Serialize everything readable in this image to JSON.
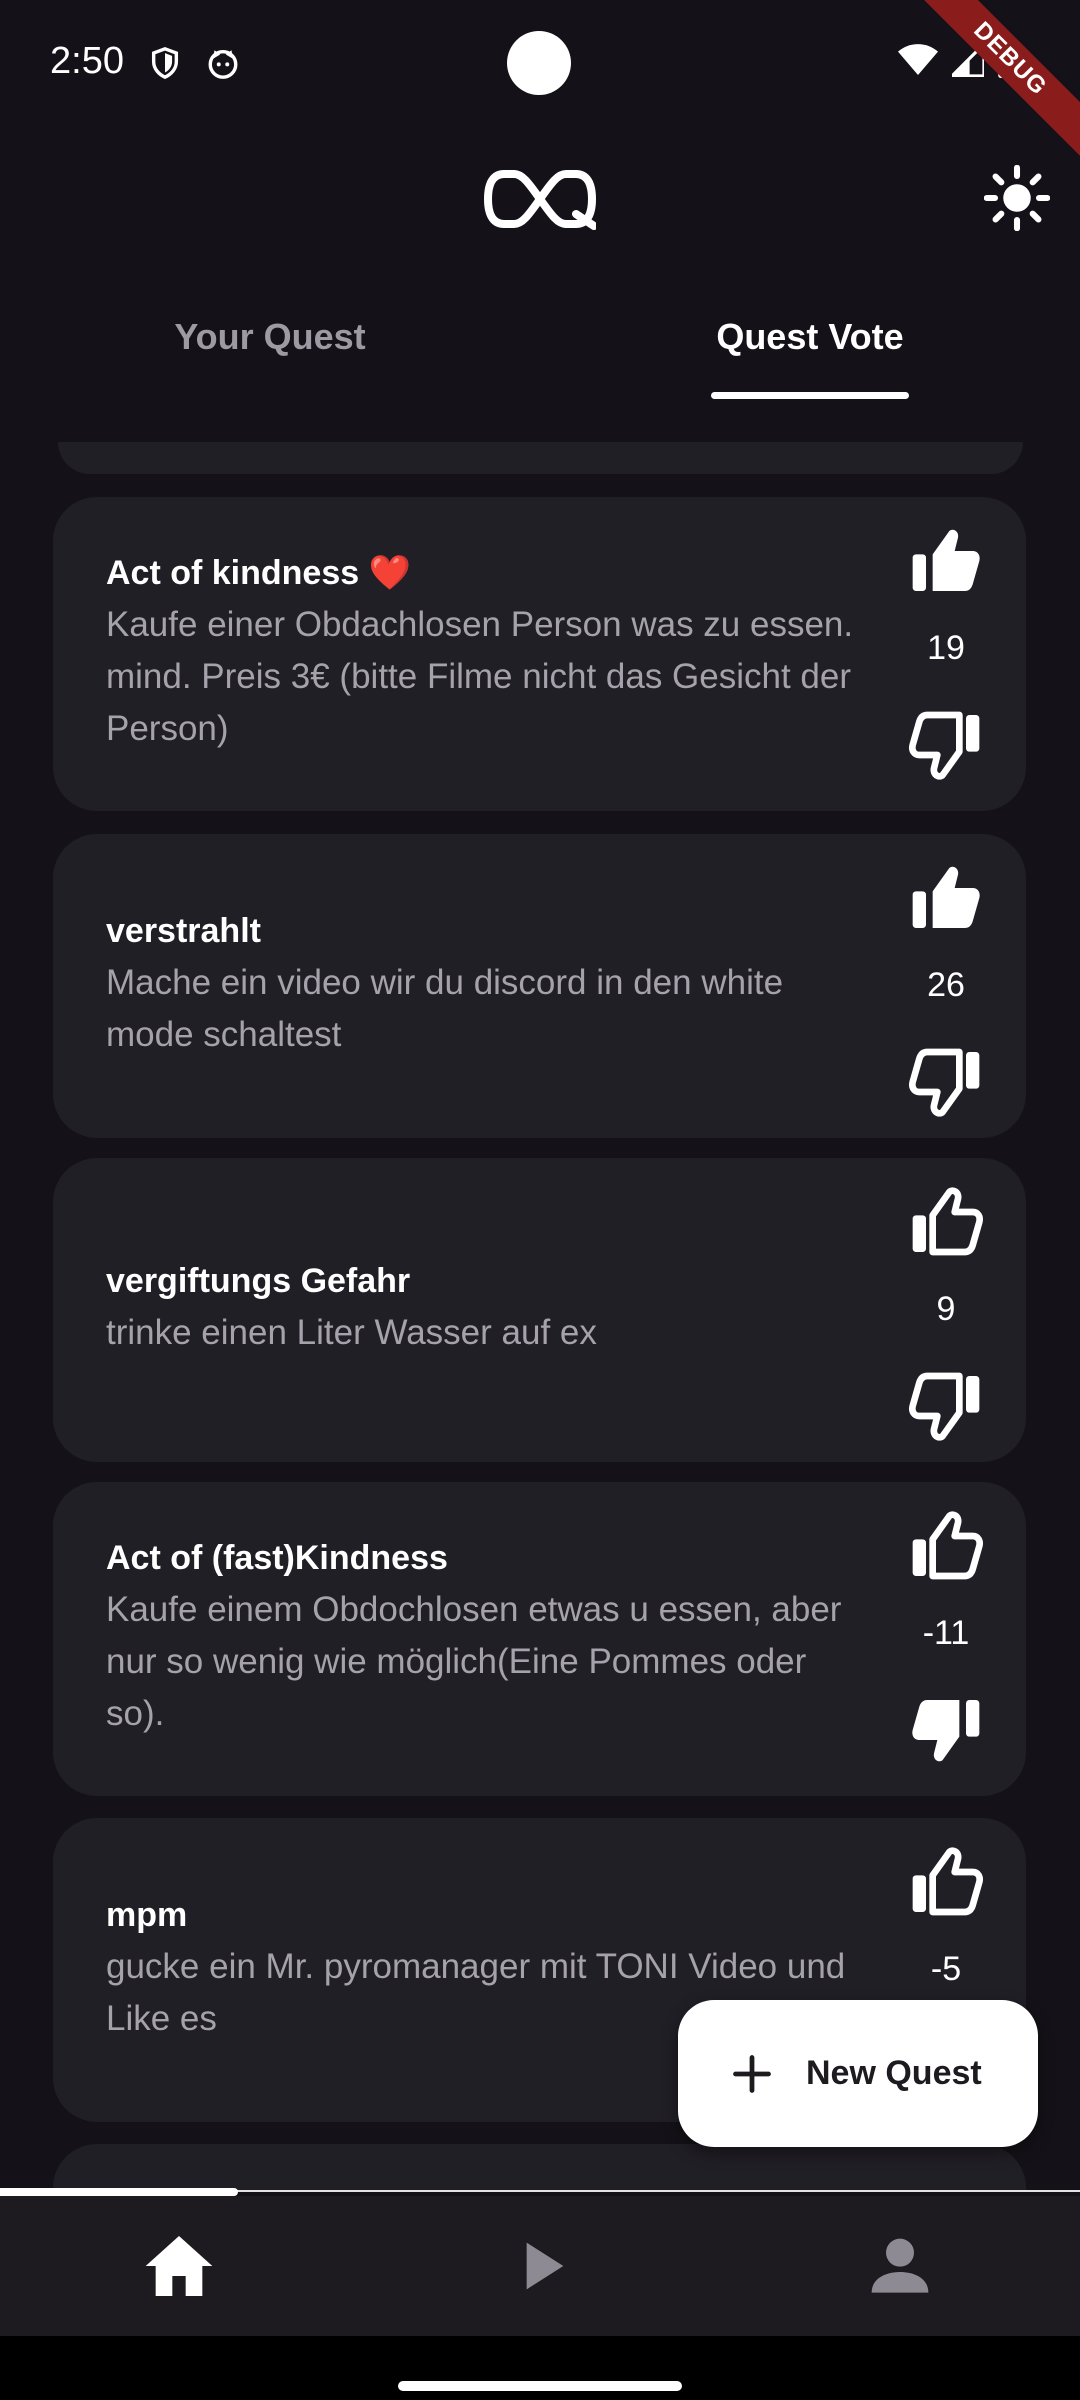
{
  "status_bar": {
    "time": "2:50",
    "icons": [
      "shield-icon",
      "cat-face-icon",
      "wifi-icon",
      "signal-icon",
      "battery-icon"
    ],
    "debug_label": "DEBUG"
  },
  "app_bar": {
    "logo_icon": "quest-logo-icon",
    "theme_icon": "sun-icon"
  },
  "tabs": [
    {
      "label": "Your Quest",
      "selected": false
    },
    {
      "label": "Quest Vote",
      "selected": true
    }
  ],
  "quests": [
    {
      "title": "Act of kindness ❤️",
      "description": "Kaufe einer Obdachlosen Person was zu essen. mind. Preis 3€ (bitte Filme nicht das Gesicht der Person)",
      "votes": "19",
      "user_vote": "up"
    },
    {
      "title": "verstrahlt",
      "description": "Mache ein video wir du discord in den white mode schaltest",
      "votes": "26",
      "user_vote": "up"
    },
    {
      "title": "vergiftungs Gefahr",
      "description": "trinke  einen Liter Wasser auf ex",
      "votes": "9",
      "user_vote": "none"
    },
    {
      "title": "Act of (fast)Kindness",
      "description": "Kaufe einem Obdochlosen etwas u essen, aber nur so wenig wie möglich(Eine Pommes oder so).",
      "votes": "-11",
      "user_vote": "down"
    },
    {
      "title": "mpm",
      "description": "gucke ein Mr. pyromanager mit TONI Video und Like es",
      "votes": "-5",
      "user_vote": "none"
    }
  ],
  "fab": {
    "label": "New Quest",
    "icon": "plus-icon"
  },
  "page_progress": 0.22,
  "bottom_nav": [
    {
      "name": "home",
      "icon": "home-icon",
      "active": true
    },
    {
      "name": "play",
      "icon": "play-icon",
      "active": false
    },
    {
      "name": "profile",
      "icon": "person-icon",
      "active": false
    }
  ],
  "colors": {
    "background": "#141218",
    "card": "#211f26",
    "text_primary": "#ffffff",
    "text_secondary": "#a6a2ab",
    "debug_banner": "#8a1c1c"
  }
}
